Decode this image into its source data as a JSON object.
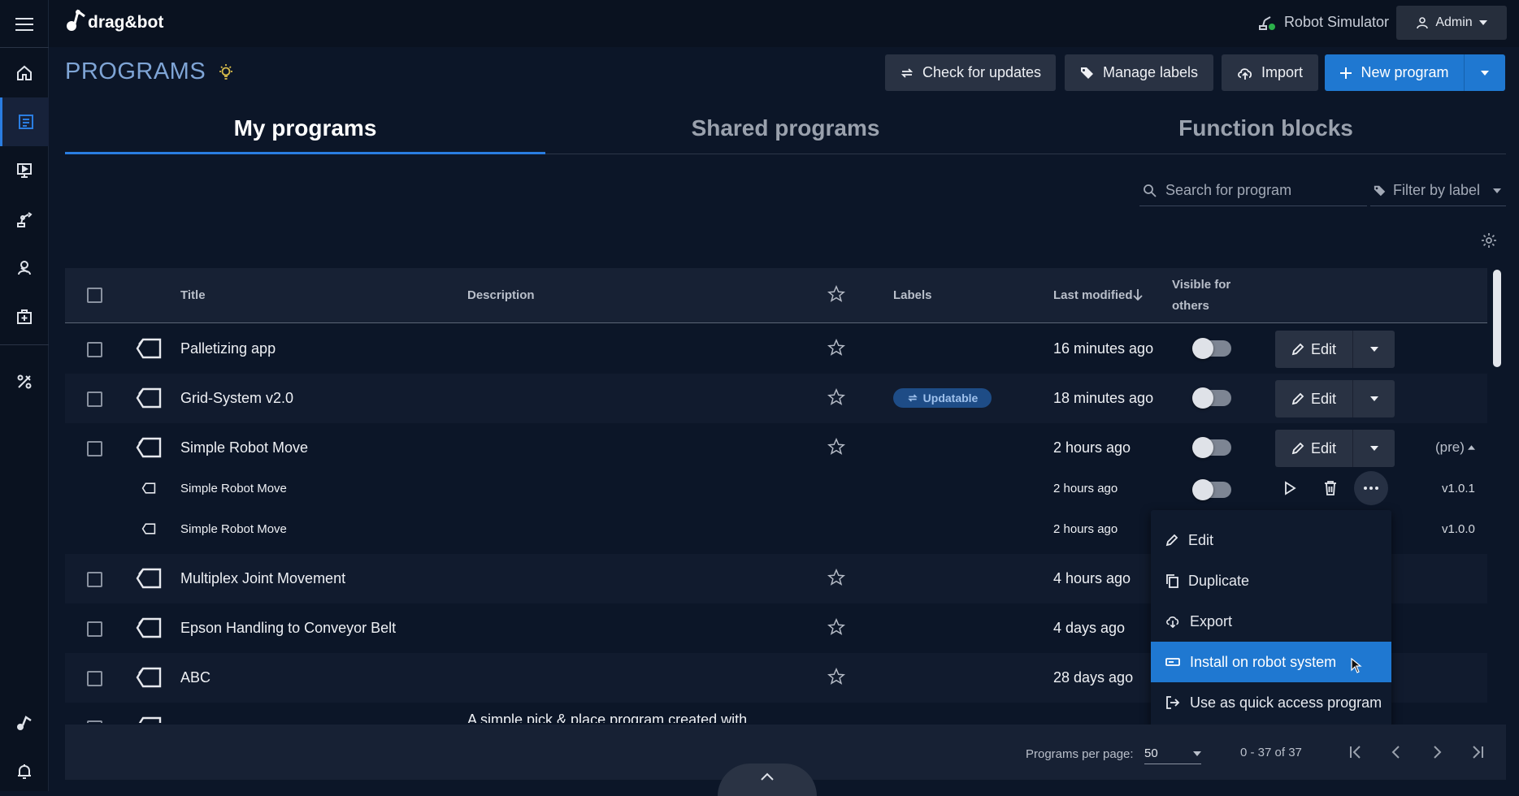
{
  "app": {
    "logo_text": "drag&bot",
    "simulator_label": "Robot Simulator",
    "user_label": "Admin"
  },
  "page": {
    "title": "PROGRAMS"
  },
  "header_buttons": {
    "check_updates": "Check for updates",
    "manage_labels": "Manage labels",
    "import": "Import",
    "new_program": "New program"
  },
  "tabs": [
    {
      "label": "My programs"
    },
    {
      "label": "Shared programs"
    },
    {
      "label": "Function blocks"
    }
  ],
  "search": {
    "placeholder": "Search for program"
  },
  "filter": {
    "label": "Filter by label"
  },
  "table": {
    "columns": {
      "title": "Title",
      "description": "Description",
      "labels": "Labels",
      "last_modified": "Last modified",
      "visible_line1": "Visible for",
      "visible_line2": "others"
    },
    "rows": [
      {
        "title": "Palletizing app",
        "modified": "16 minutes ago",
        "edit": "Edit"
      },
      {
        "title": "Grid-System v2.0",
        "label": "Updatable",
        "modified": "18 minutes ago",
        "edit": "Edit"
      },
      {
        "title": "Simple Robot Move",
        "modified": "2 hours ago",
        "edit": "Edit",
        "version_toggle": "(pre)"
      },
      {
        "title": "Multiplex Joint Movement",
        "modified": "4 hours ago"
      },
      {
        "title": "Epson Handling to Conveyor Belt",
        "modified": "4 days ago"
      },
      {
        "title": "ABC",
        "modified": "28 days ago"
      }
    ],
    "subrows": [
      {
        "title": "Simple Robot Move",
        "modified": "2 hours ago",
        "version": "v1.0.1"
      },
      {
        "title": "Simple Robot Move",
        "modified": "2 hours ago",
        "version": "v1.0.0"
      }
    ],
    "partial_description": "A simple pick & place program created with"
  },
  "context_menu": {
    "items": [
      {
        "label": "Edit",
        "icon": "pencil-icon"
      },
      {
        "label": "Duplicate",
        "icon": "copy-icon"
      },
      {
        "label": "Export",
        "icon": "cloud-download-icon"
      },
      {
        "label": "Install on robot system",
        "icon": "install-icon",
        "highlighted": true
      },
      {
        "label": "Use as quick access program",
        "icon": "quick-access-icon"
      }
    ]
  },
  "footer": {
    "per_page_label": "Programs per page:",
    "per_page_value": "50",
    "range": "0 - 37 of 37"
  }
}
